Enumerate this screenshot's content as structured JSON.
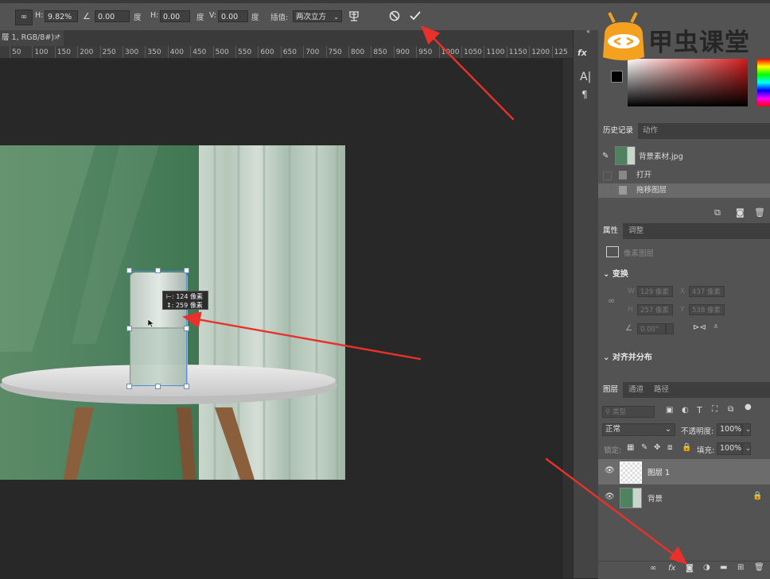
{
  "options_bar": {
    "h_label": "H:",
    "h_value": "9.82%",
    "angle_value": "0.00",
    "deg1": "度",
    "hskew_label": "H:",
    "hskew_value": "0.00",
    "deg2": "度",
    "vskew_label": "V:",
    "vskew_value": "0.00",
    "deg3": "度",
    "interp_label": "插值:",
    "interp_value": "两次立方"
  },
  "document": {
    "tab_title": "層 1, RGB/8#) *",
    "close_glyph": "×",
    "ruler_ticks": [
      "50",
      "100",
      "150",
      "200",
      "250",
      "300",
      "350",
      "400",
      "450",
      "500",
      "550",
      "600",
      "650",
      "700",
      "750",
      "800",
      "850",
      "900",
      "950",
      "1000",
      "1050",
      "1100",
      "1150",
      "1200",
      "125"
    ]
  },
  "transform_tooltip": {
    "width_line": "⊢: 124 像素",
    "height_line": "↕: 259 像素"
  },
  "watermark": {
    "text": "甲虫课堂"
  },
  "history_panel": {
    "tabs": [
      "历史记录",
      "动作"
    ],
    "snapshot_name": "背景素材.jpg",
    "items": [
      "打开",
      "拖移图层"
    ]
  },
  "properties_panel": {
    "tabs": [
      "属性",
      "调整"
    ],
    "type_label": "像素图层",
    "transform_header": "变换",
    "w_label": "W",
    "w_value": "129 像素",
    "x_label": "X",
    "x_value": "437 像素",
    "h_label": "H",
    "h_value": "257 像素",
    "y_label": "Y",
    "y_value": "538 像素",
    "angle_value": "0.00°",
    "align_header": "对齐并分布"
  },
  "layers_panel": {
    "tabs": [
      "图层",
      "通道",
      "路径"
    ],
    "filter_placeholder": "类型",
    "blend_mode": "正常",
    "opacity_label": "不透明度:",
    "opacity_value": "100%",
    "lock_label": "锁定:",
    "fill_label": "填充:",
    "fill_value": "100%",
    "layers": [
      {
        "name": "图层 1",
        "selected": true
      },
      {
        "name": "背景",
        "selected": false
      }
    ]
  },
  "colors": {
    "accent_arrow": "#e8312a",
    "panel_bg": "#535353",
    "canvas_bg": "#282828",
    "selection_handle": "#5b8fd6"
  }
}
